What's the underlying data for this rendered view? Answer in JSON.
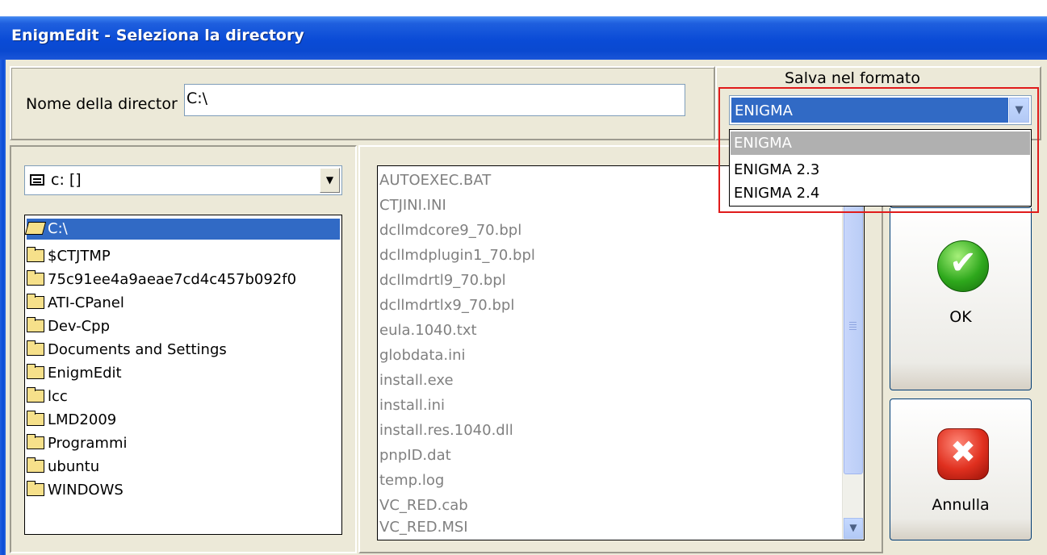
{
  "window": {
    "title": "EnigmEdit - Seleziona la directory",
    "top_strip_text": "··· · ··· · · · ·· ··"
  },
  "directory": {
    "label": "Nome della director",
    "value": "C:\\"
  },
  "format": {
    "label": "Salva nel formato",
    "selected": "ENIGMA",
    "options": [
      "ENIGMA",
      "ENIGMA 2.3",
      "ENIGMA 2.4"
    ],
    "highlighted_index": 0
  },
  "drive": {
    "value": "c: []",
    "icon": "drive-icon"
  },
  "folders": {
    "current": "C:\\",
    "items": [
      "$CTJTMP",
      "75c91ee4a9aeae7cd4c457b092f0",
      "ATI-CPanel",
      "Dev-Cpp",
      "Documents and Settings",
      "EnigmEdit",
      "lcc",
      "LMD2009",
      "Programmi",
      "ubuntu",
      "WINDOWS"
    ]
  },
  "files": [
    "AUTOEXEC.BAT",
    "CTJINI.INI",
    "dcllmdcore9_70.bpl",
    "dcllmdplugin1_70.bpl",
    "dcllmdrtl9_70.bpl",
    "dcllmdrtlx9_70.bpl",
    "eula.1040.txt",
    "globdata.ini",
    "install.exe",
    "install.ini",
    "install.res.1040.dll",
    "pnpID.dat",
    "temp.log",
    "VC_RED.cab",
    "VC_RED.MSI"
  ],
  "buttons": {
    "ok": "OK",
    "cancel": "Annulla"
  },
  "colors": {
    "selection": "#316ac5",
    "title_bar": "#0a4bd6",
    "annotation": "#e01b1b",
    "ok_icon": "#2ea81c",
    "cancel_icon": "#e0301f"
  }
}
